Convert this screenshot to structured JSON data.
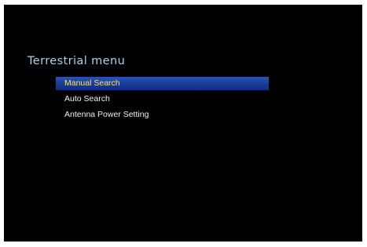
{
  "menu": {
    "title": "Terrestrial menu",
    "items": [
      {
        "label": "Manual Search",
        "selected": true
      },
      {
        "label": "Auto Search",
        "selected": false
      },
      {
        "label": "Antenna Power Setting",
        "selected": false
      }
    ]
  },
  "colors": {
    "background": "#000000",
    "title": "#a9d4ea",
    "item_text": "#f2f2f2",
    "selected_text": "#ffe06a",
    "selected_bar": "#1d43a0"
  }
}
